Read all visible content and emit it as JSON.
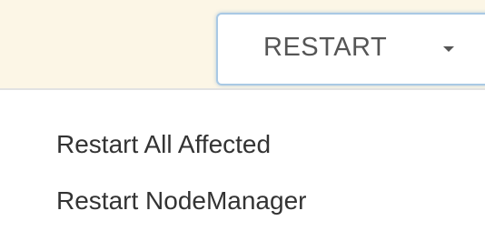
{
  "toolbar": {
    "restart_label": "RESTART",
    "caret_icon": "chevron-down-icon"
  },
  "dropdown": {
    "items": [
      {
        "label": "Restart All Affected"
      },
      {
        "label": "Restart NodeManager"
      }
    ]
  },
  "colors": {
    "toolbar_background": "#fcf6e6",
    "button_border": "#a9c9e4",
    "button_text": "#555555",
    "menu_text": "#333333"
  }
}
